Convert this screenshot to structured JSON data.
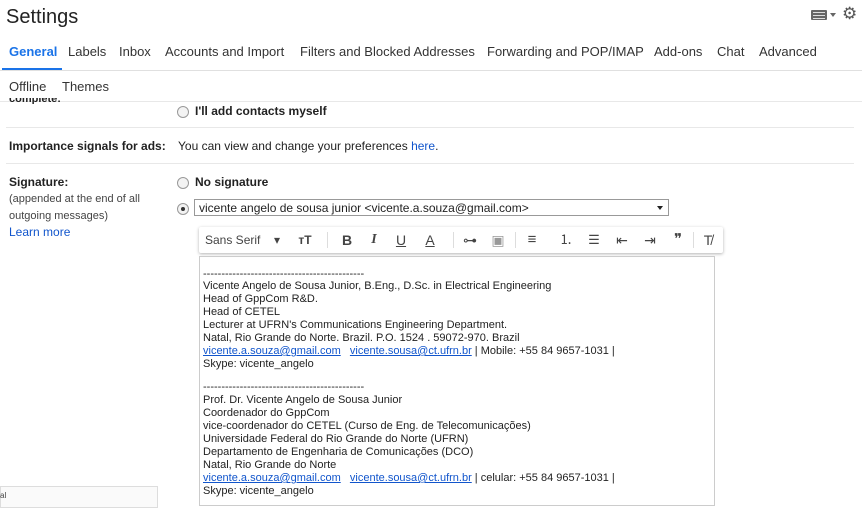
{
  "header": {
    "title": "Settings",
    "keyboard_icon": "keyboard-icon",
    "settings_icon": "gear-icon"
  },
  "tabs_row1": [
    "General",
    "Labels",
    "Inbox",
    "Accounts and Import",
    "Filters and Blocked Addresses",
    "Forwarding and POP/IMAP",
    "Add-ons",
    "Chat",
    "Advanced"
  ],
  "tabs_row2": [
    "Offline",
    "Themes"
  ],
  "contacts": {
    "label_partial": "complete:",
    "option": "I'll add contacts myself"
  },
  "importance": {
    "label": "Importance signals for ads:",
    "text": "You can view and change your preferences",
    "link": "here",
    "period": "."
  },
  "signature": {
    "label": "Signature:",
    "sub1": "(appended at the end of all",
    "sub2": "outgoing messages)",
    "learn_more": "Learn more",
    "no_signature": "No signature",
    "selected_account": "vicente angelo de sousa junior <vicente.a.souza@gmail.com>"
  },
  "toolbar": {
    "font": "Sans Serif",
    "font_caret": "▾",
    "size": "тT",
    "bold": "B",
    "italic": "I",
    "underline": "U",
    "color": "A",
    "link": "⊶",
    "image": "▣",
    "align": "≡",
    "numbered": "⒈",
    "bulleted": "☰",
    "indent_less": "⇤",
    "indent_more": "⇥",
    "quote": "❞",
    "clear": "T̸"
  },
  "sig_block1": {
    "dashes": "--------------------------------------------",
    "line1": "Vicente Angelo de Sousa Junior, B.Eng., D.Sc. in Electrical Engineering",
    "line2": "Head of GppCom R&D.",
    "line3": "Head of CETEL",
    "line4": "Lecturer at UFRN's Communications Engineering Department.",
    "line5": "Natal, Rio Grande do Norte. Brazil. P.O. 1524 . 59072-970. Brazil",
    "email1": "vicente.a.souza@gmail.com",
    "email2": "vicente.sousa@ct.ufrn.br",
    "phone": " | Mobile: +55 84 9657-1031 |",
    "skype": "Skype: vicente_angelo"
  },
  "sig_block2": {
    "dashes": "--------------------------------------------",
    "line1": "Prof. Dr. Vicente Angelo de Sousa Junior",
    "line2": "Coordenador do GppCom",
    "line3": "vice-coordenador do CETEL (Curso de Eng. de Telecomunicações)",
    "line4": "Universidade Federal do Rio Grande do Norte (UFRN)",
    "line5": "Departamento de Engenharia de Comunicações (DCO)",
    "line6": "Natal, Rio Grande do Norte",
    "email1": "vicente.a.souza@gmail.com",
    "email2": "vicente.sousa@ct.ufrn.br",
    "phone": " | celular: +55 84 9657-1031 |",
    "skype": "Skype: vicente_angelo"
  },
  "bottom": {
    "text": "al"
  },
  "colors": {
    "accent": "#1a73e8",
    "link": "#1155cc"
  }
}
